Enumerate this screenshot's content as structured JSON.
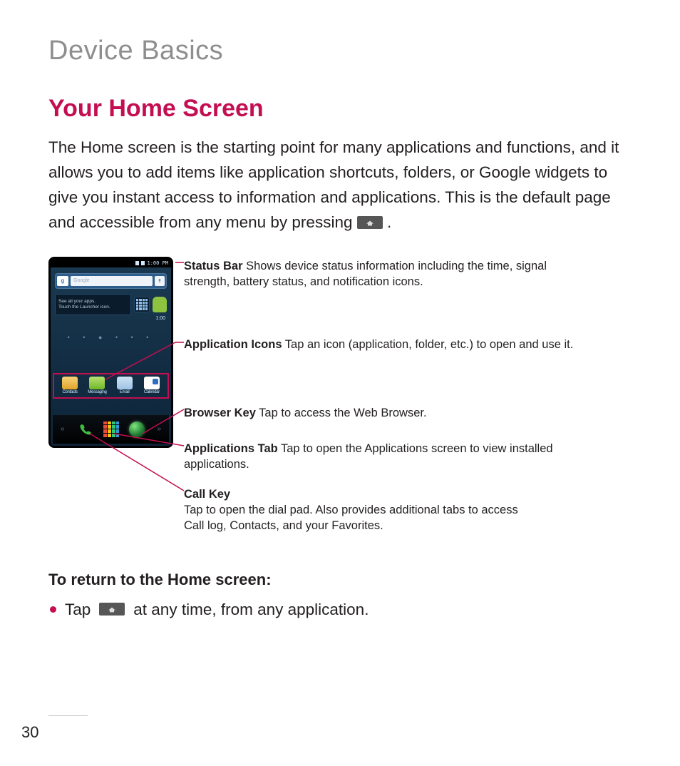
{
  "section_title": "Device Basics",
  "heading": "Your Home Screen",
  "intro_part1": "The Home screen is the starting point for many applications and functions, and it allows you to add items like application shortcuts, folders, or Google widgets to give you instant access to information and applications. This is the default page and accessible from any menu by pressing ",
  "intro_part2": " .",
  "subhead": "To return to the Home screen:",
  "bullet_before": "Tap ",
  "bullet_after": " at any time, from any application.",
  "page_number": "30",
  "phone": {
    "status_time": "1:00 PM",
    "search_letter": "g",
    "search_placeholder": "Google",
    "tip_line1": "See all your apps.",
    "tip_line2": "Touch the Launcher icon.",
    "clock_time": "1:00",
    "dock": [
      {
        "label": "Contacts"
      },
      {
        "label": "Messaging"
      },
      {
        "label": "Email"
      },
      {
        "label": "Calendar"
      }
    ],
    "bottom_arrow_left": "«",
    "bottom_arrow_right": "»"
  },
  "callouts": {
    "status": {
      "title": "Status Bar",
      "text": " Shows device status information including the time, signal strength, battery status, and notification icons."
    },
    "app_icons": {
      "title": "Application Icons",
      "text": " Tap an icon (application, folder, etc.) to open and use it."
    },
    "browser": {
      "title": "Browser Key",
      "text": " Tap to access the Web Browser."
    },
    "apps_tab": {
      "title": "Applications Tab",
      "text": " Tap to open the Applications screen to view installed applications."
    },
    "call": {
      "title": "Call Key",
      "text_line1": "Tap to open the dial pad. Also provides additional tabs to access",
      "text_line2": "Call log, Contacts, and your Favorites."
    }
  }
}
